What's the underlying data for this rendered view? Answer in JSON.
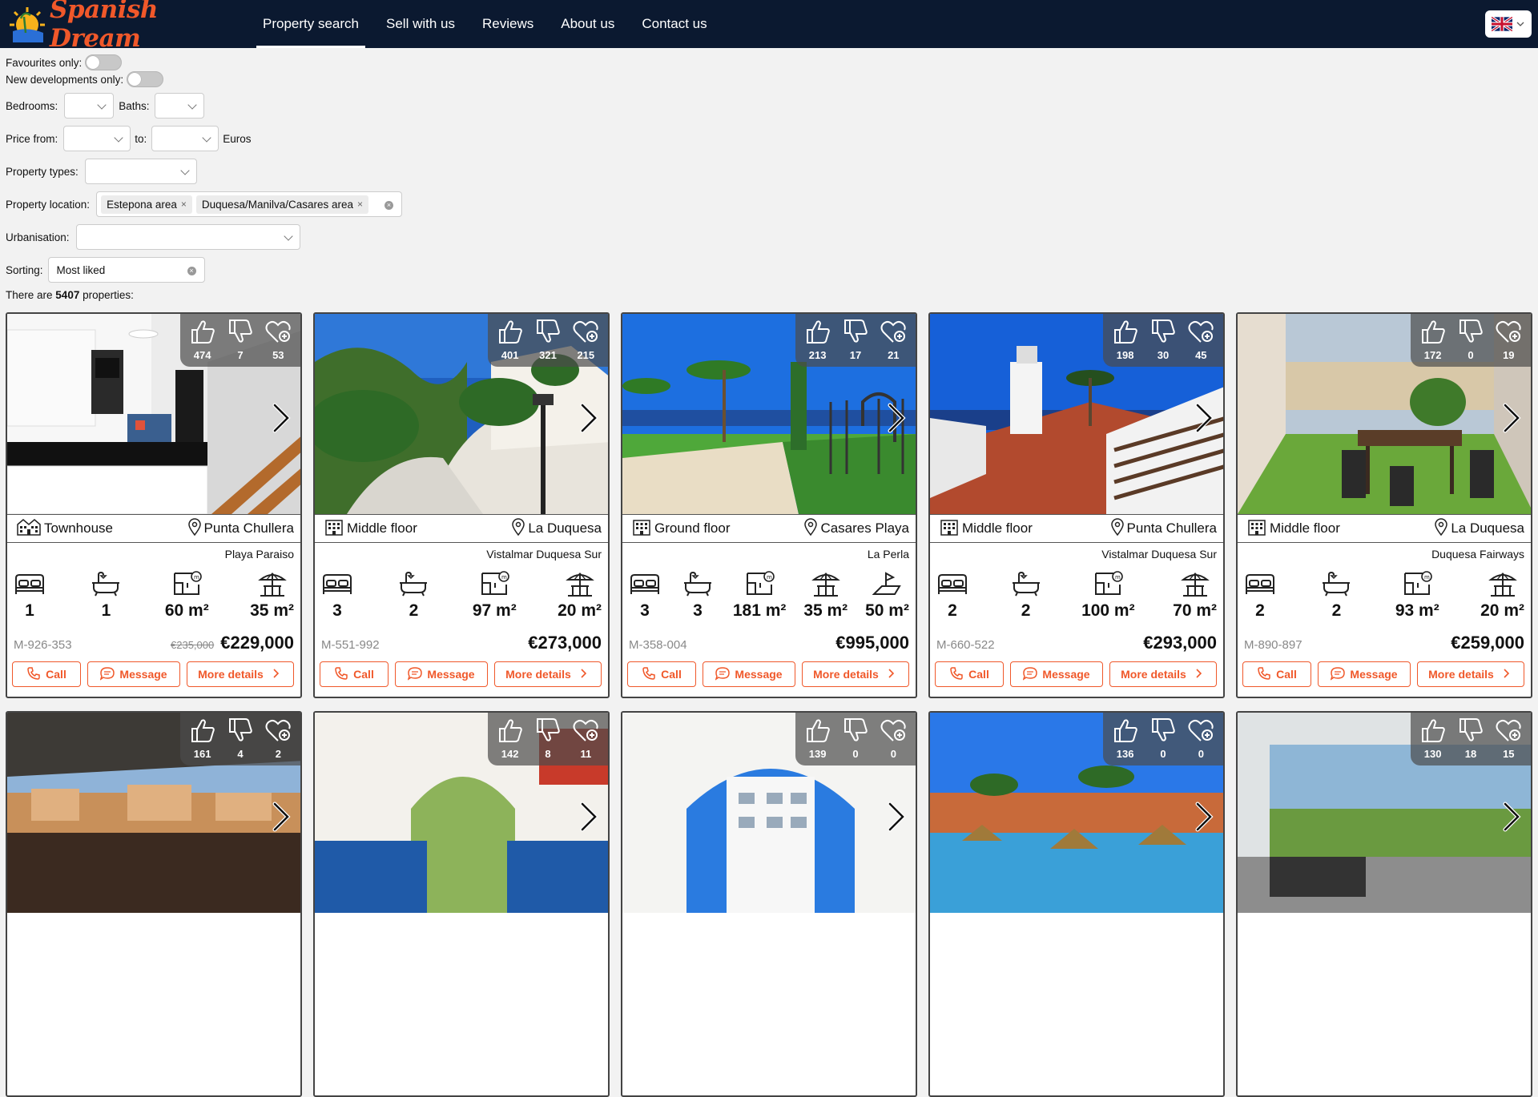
{
  "brand": {
    "name": "Spanish Dream"
  },
  "nav": {
    "items": [
      "Property search",
      "Sell with us",
      "Reviews",
      "About us",
      "Contact us"
    ],
    "active": 0
  },
  "filters": {
    "favourites_label": "Favourites only:",
    "newdev_label": "New developments only:",
    "bedrooms_label": "Bedrooms:",
    "baths_label": "Baths:",
    "price_from_label": "Price from:",
    "price_to_label": "to:",
    "currency_label": "Euros",
    "types_label": "Property types:",
    "location_label": "Property location:",
    "locations": [
      "Estepona area",
      "Duquesa/Manilva/Casares area"
    ],
    "urbanisation_label": "Urbanisation:",
    "sorting_label": "Sorting:",
    "sorting_value": "Most liked",
    "count_prefix": "There are",
    "count": "5407",
    "count_suffix": "properties:"
  },
  "buttons": {
    "call": "Call",
    "message": "Message",
    "more": "More details"
  },
  "colors": {
    "brand": "#f0582a",
    "nav": "#0b1930"
  },
  "cards": [
    {
      "likes": "474",
      "dislikes": "7",
      "favs": "53",
      "type": "Townhouse",
      "location": "Punta Chullera",
      "urbanisation": "Playa Paraiso",
      "beds": "1",
      "baths": "1",
      "built": "60 m²",
      "terrace": "35 m²",
      "plot": "",
      "ref": "M-926-353",
      "old_price": "€235,000",
      "price": "€229,000",
      "scene": "kitchen"
    },
    {
      "likes": "401",
      "dislikes": "321",
      "favs": "215",
      "type": "Middle floor",
      "location": "La Duquesa",
      "urbanisation": "Vistalmar Duquesa Sur",
      "beds": "3",
      "baths": "2",
      "built": "97 m²",
      "terrace": "20 m²",
      "plot": "",
      "ref": "M-551-992",
      "old_price": "",
      "price": "€273,000",
      "scene": "garden"
    },
    {
      "likes": "213",
      "dislikes": "17",
      "favs": "21",
      "type": "Ground floor",
      "location": "Casares Playa",
      "urbanisation": "La Perla",
      "beds": "3",
      "baths": "3",
      "built": "181 m²",
      "terrace": "35 m²",
      "plot": "50 m²",
      "ref": "M-358-004",
      "old_price": "",
      "price": "€995,000",
      "scene": "lawn"
    },
    {
      "likes": "198",
      "dislikes": "30",
      "favs": "45",
      "type": "Middle floor",
      "location": "Punta Chullera",
      "urbanisation": "Vistalmar Duquesa Sur",
      "beds": "2",
      "baths": "2",
      "built": "100 m²",
      "terrace": "70 m²",
      "plot": "",
      "ref": "M-660-522",
      "old_price": "",
      "price": "€293,000",
      "scene": "terrace"
    },
    {
      "likes": "172",
      "dislikes": "0",
      "favs": "19",
      "type": "Middle floor",
      "location": "La Duquesa",
      "urbanisation": "Duquesa Fairways",
      "beds": "2",
      "baths": "2",
      "built": "93 m²",
      "terrace": "20 m²",
      "plot": "",
      "ref": "M-890-897",
      "old_price": "",
      "price": "€259,000",
      "scene": "patio"
    },
    {
      "likes": "161",
      "dislikes": "4",
      "favs": "2",
      "scene": "balcony"
    },
    {
      "likes": "142",
      "dislikes": "8",
      "favs": "11",
      "scene": "lounge"
    },
    {
      "likes": "139",
      "dislikes": "0",
      "favs": "0",
      "scene": "arch"
    },
    {
      "likes": "136",
      "dislikes": "0",
      "favs": "0",
      "scene": "pool"
    },
    {
      "likes": "130",
      "dislikes": "18",
      "favs": "15",
      "scene": "glass"
    }
  ]
}
